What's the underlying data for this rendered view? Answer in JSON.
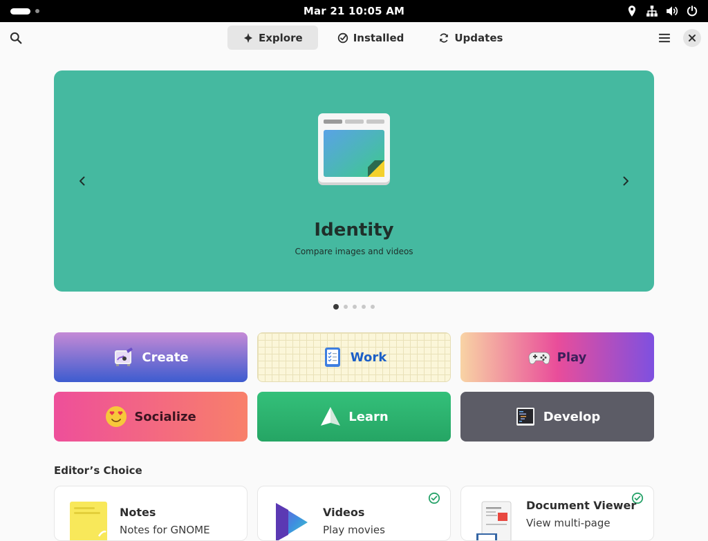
{
  "system_bar": {
    "clock": "Mar 21  10:05 AM",
    "icons": [
      "location-icon",
      "network-icon",
      "volume-icon",
      "power-icon"
    ]
  },
  "header": {
    "tabs": [
      {
        "label": "Explore",
        "icon": "sparkle-icon",
        "active": true
      },
      {
        "label": "Installed",
        "icon": "check-circle-icon",
        "active": false
      },
      {
        "label": "Updates",
        "icon": "refresh-icon",
        "active": false
      }
    ],
    "search_icon": "search-icon",
    "menu_icon": "hamburger-menu-icon",
    "close_icon": "close-icon"
  },
  "carousel": {
    "title": "Identity",
    "subtitle": "Compare images and videos",
    "background_color": "#45b9a0",
    "page_count": 5,
    "active_page": 1
  },
  "categories": [
    {
      "label": "Create",
      "icon": "create-icon"
    },
    {
      "label": "Work",
      "icon": "work-icon"
    },
    {
      "label": "Play",
      "icon": "gamepad-icon"
    },
    {
      "label": "Socialize",
      "icon": "heart-eyes-emoji-icon"
    },
    {
      "label": "Learn",
      "icon": "paper-plane-icon"
    },
    {
      "label": "Develop",
      "icon": "terminal-icon"
    }
  ],
  "editors_choice": {
    "title": "Editor’s Choice",
    "apps": [
      {
        "name": "Notes",
        "description": "Notes for GNOME",
        "installed": false,
        "icon": "notes-app-icon"
      },
      {
        "name": "Videos",
        "description": "Play movies",
        "installed": true,
        "icon": "videos-app-icon"
      },
      {
        "name": "Document Viewer",
        "description": "View multi-page",
        "installed": true,
        "icon": "document-viewer-app-icon"
      }
    ]
  }
}
